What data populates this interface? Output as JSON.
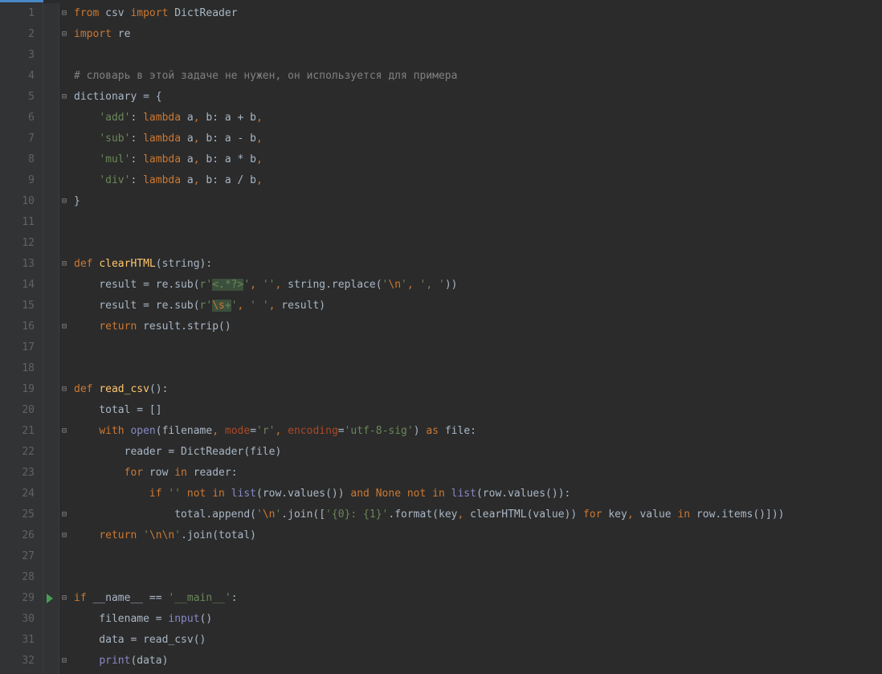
{
  "lines": [
    {
      "n": 1,
      "marker": "",
      "fold": "⊟",
      "html": "<span class='kw'>from</span> csv <span class='kw'>import</span> DictReader"
    },
    {
      "n": 2,
      "marker": "",
      "fold": "⊟",
      "html": "<span class='kw'>import</span> re"
    },
    {
      "n": 3,
      "marker": "",
      "fold": "",
      "html": ""
    },
    {
      "n": 4,
      "marker": "",
      "fold": "",
      "html": "<span class='cmt'># словарь в этой задаче не нужен, он используется для примера</span>"
    },
    {
      "n": 5,
      "marker": "",
      "fold": "⊟",
      "html": "dictionary = {"
    },
    {
      "n": 6,
      "marker": "",
      "fold": "",
      "html": "    <span class='str'>'add'</span>: <span class='kw'>lambda</span> a<span class='kw'>,</span> b: a + b<span class='kw'>,</span>"
    },
    {
      "n": 7,
      "marker": "",
      "fold": "",
      "html": "    <span class='str'>'sub'</span>: <span class='kw'>lambda</span> a<span class='kw'>,</span> b: a - b<span class='kw'>,</span>"
    },
    {
      "n": 8,
      "marker": "",
      "fold": "",
      "html": "    <span class='str'>'mul'</span>: <span class='kw'>lambda</span> a<span class='kw'>,</span> b: a * b<span class='kw'>,</span>"
    },
    {
      "n": 9,
      "marker": "",
      "fold": "",
      "html": "    <span class='str'>'div'</span>: <span class='kw'>lambda</span> a<span class='kw'>,</span> b: a / b<span class='kw'>,</span>"
    },
    {
      "n": 10,
      "marker": "",
      "fold": "⊟",
      "html": "}"
    },
    {
      "n": 11,
      "marker": "",
      "fold": "",
      "html": ""
    },
    {
      "n": 12,
      "marker": "",
      "fold": "",
      "html": ""
    },
    {
      "n": 13,
      "marker": "",
      "fold": "⊟",
      "html": "<span class='kw'>def</span> <span class='fn'>clearHTML</span>(string):"
    },
    {
      "n": 14,
      "marker": "",
      "fold": "",
      "html": "    result = re.sub(<span class='str'>r'</span><span class='regex-hl'>&lt;.*?&gt;</span><span class='str'>'</span><span class='kw'>,</span> <span class='str'>''</span><span class='kw'>,</span> string.replace(<span class='str'>'</span><span class='escape'>\\n</span><span class='str'>'</span><span class='kw'>,</span> <span class='str'>', '</span>))"
    },
    {
      "n": 15,
      "marker": "",
      "fold": "",
      "html": "    result = re.sub(<span class='str'>r'</span><span class='regex-hl'><span class='escape'>\\s</span>+</span><span class='str'>'</span><span class='kw'>,</span> <span class='str'>' '</span><span class='kw'>,</span> result)"
    },
    {
      "n": 16,
      "marker": "",
      "fold": "⊟",
      "html": "    <span class='kw'>return</span> result.strip()"
    },
    {
      "n": 17,
      "marker": "",
      "fold": "",
      "html": ""
    },
    {
      "n": 18,
      "marker": "",
      "fold": "",
      "html": ""
    },
    {
      "n": 19,
      "marker": "",
      "fold": "⊟",
      "html": "<span class='kw'>def</span> <span class='fn'>read_csv</span>():"
    },
    {
      "n": 20,
      "marker": "",
      "fold": "",
      "html": "    total = []"
    },
    {
      "n": 21,
      "marker": "",
      "fold": "⊟",
      "html": "    <span class='kw'>with</span> <span class='bltn'>open</span>(filename<span class='kw'>,</span> <span class='param'>mode</span>=<span class='str'>'r'</span><span class='kw'>,</span> <span class='param'>encoding</span>=<span class='str'>'utf-8-sig'</span>) <span class='kw'>as</span> file:"
    },
    {
      "n": 22,
      "marker": "",
      "fold": "",
      "html": "        reader = DictReader(file)"
    },
    {
      "n": 23,
      "marker": "",
      "fold": "",
      "html": "        <span class='kw'>for</span> row <span class='kw'>in</span> reader:"
    },
    {
      "n": 24,
      "marker": "",
      "fold": "",
      "html": "            <span class='kw'>if</span> <span class='str'>''</span> <span class='kw'>not in</span> <span class='bltn'>list</span>(row.values()) <span class='kw'>and</span> <span class='kw'>None</span> <span class='kw'>not in</span> <span class='bltn'>list</span>(row.values()):"
    },
    {
      "n": 25,
      "marker": "",
      "fold": "⊟",
      "html": "                total.append(<span class='str'>'</span><span class='escape'>\\n</span><span class='str'>'</span>.join([<span class='str'>'{0}: {1}'</span>.format(key<span class='kw'>,</span> clearHTML(value)) <span class='kw'>for</span> key<span class='kw'>,</span> value <span class='kw'>in</span> row.items()]))"
    },
    {
      "n": 26,
      "marker": "",
      "fold": "⊟",
      "html": "    <span class='kw'>return</span> <span class='str'>'</span><span class='escape'>\\n\\n</span><span class='str'>'</span>.join(total)"
    },
    {
      "n": 27,
      "marker": "",
      "fold": "",
      "html": ""
    },
    {
      "n": 28,
      "marker": "",
      "fold": "",
      "html": ""
    },
    {
      "n": 29,
      "marker": "run",
      "fold": "⊟",
      "html": "<span class='kw'>if</span> __name__ == <span class='str'>'__main__'</span>:"
    },
    {
      "n": 30,
      "marker": "",
      "fold": "",
      "html": "    filename = <span class='bltn'>input</span>()"
    },
    {
      "n": 31,
      "marker": "",
      "fold": "",
      "html": "    data = read_csv()"
    },
    {
      "n": 32,
      "marker": "",
      "fold": "⊟",
      "html": "    <span class='bltn'>print</span>(data)"
    }
  ]
}
